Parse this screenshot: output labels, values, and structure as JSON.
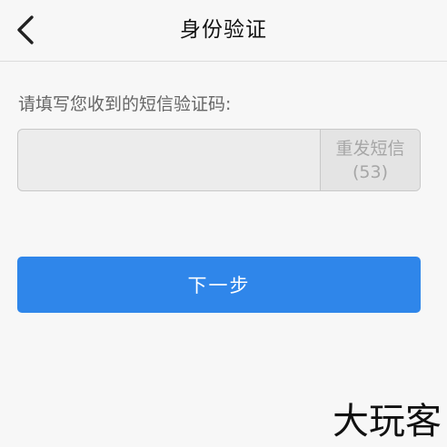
{
  "header": {
    "title": "身份验证",
    "back_icon": "chevron-left-icon"
  },
  "form": {
    "prompt": "请填写您收到的短信验证码:",
    "code_input": {
      "value": "",
      "placeholder": ""
    },
    "resend": {
      "label": "重发短信",
      "countdown": "(53)"
    },
    "next_label": "下一步"
  },
  "watermark": "大玩客",
  "colors": {
    "accent": "#2f86ea",
    "background": "#f7f7f7",
    "disabled_text": "#a6a6a6"
  }
}
